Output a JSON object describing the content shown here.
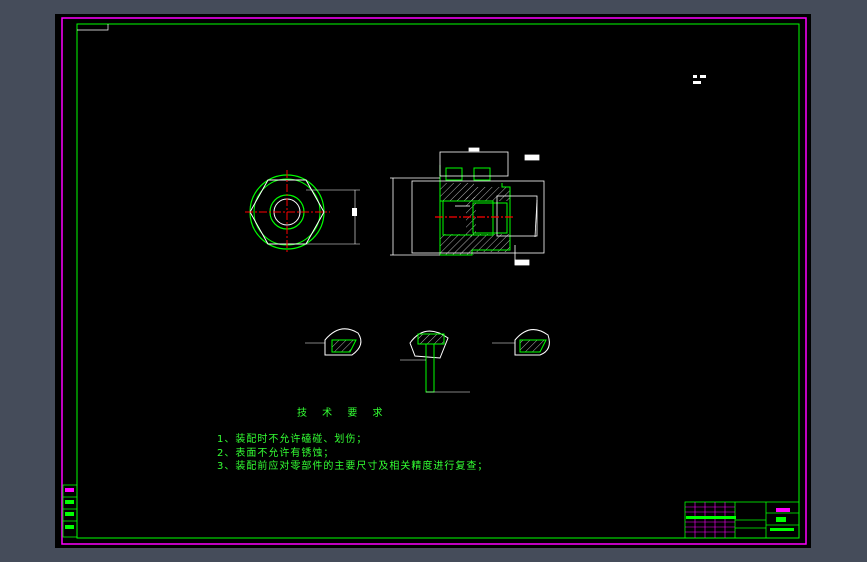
{
  "colors": {
    "background": "#000000",
    "frame": "#ff00ff",
    "border": "#00ff00",
    "outline": "#ffffff",
    "centerline": "#ff0000",
    "text": "#33ff33"
  },
  "technical_requirements": {
    "title": "技 术 要 求",
    "items": [
      "1、装配时不允许磕碰、划伤；",
      "2、表面不允许有锈蚀；",
      "3、装配前应对零部件的主要尺寸及相关精度进行复查；"
    ]
  }
}
